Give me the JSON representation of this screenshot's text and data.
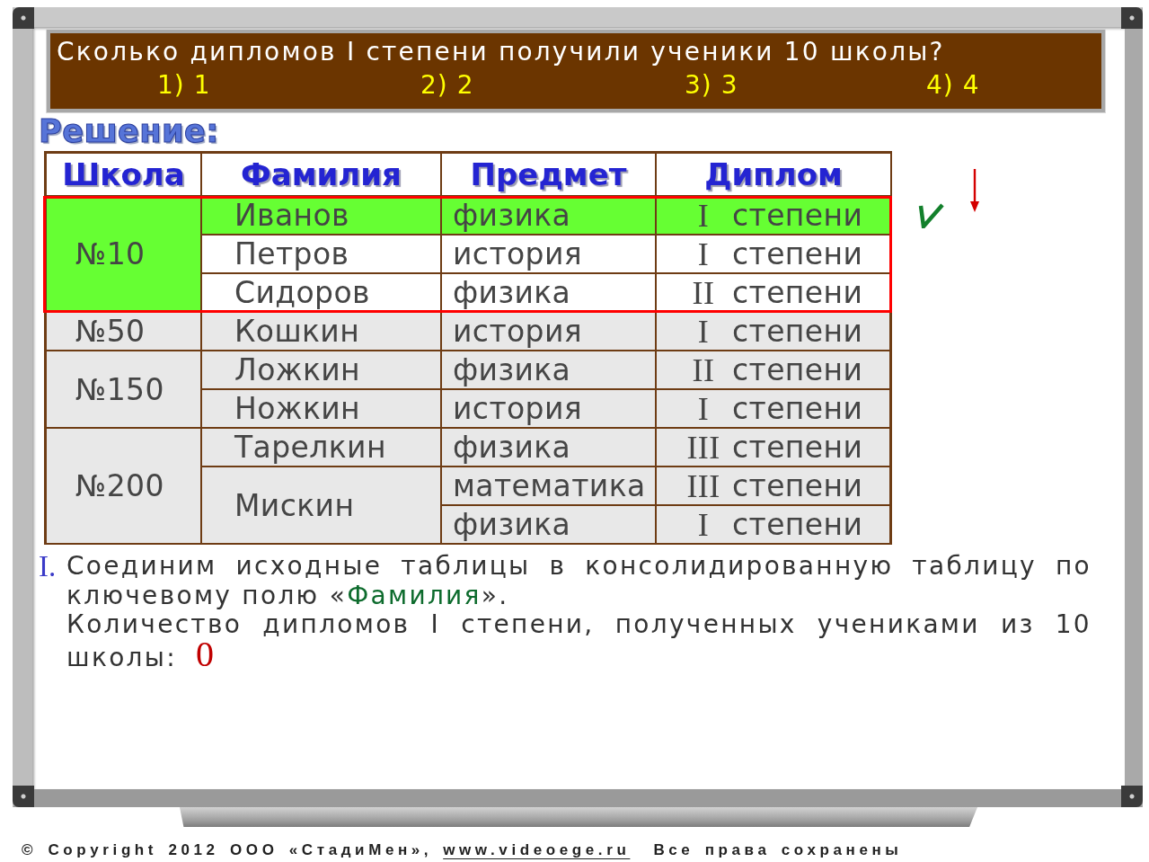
{
  "question": {
    "text": "Сколько дипломов I степени получили ученики 10 школы?",
    "options": [
      "1) 1",
      "2) 2",
      "3) 3",
      "4) 4"
    ]
  },
  "solution_heading": "Решение:",
  "table": {
    "columns": [
      "Школа",
      "Фамилия",
      "Предмет",
      "Диплом"
    ],
    "groups": [
      {
        "school": "№10",
        "selected": true,
        "highlighted": true,
        "students": [
          {
            "name": "Иванов",
            "highlighted": true,
            "subjects": [
              {
                "subject": "физика",
                "degree": "I",
                "diploma": "степени",
                "highlighted": true,
                "checked": true
              }
            ]
          },
          {
            "name": "Петров",
            "highlighted": false,
            "subjects": [
              {
                "subject": "история",
                "degree": "I",
                "diploma": "степени",
                "highlighted": false,
                "checked": false
              }
            ]
          },
          {
            "name": "Сидоров",
            "highlighted": false,
            "subjects": [
              {
                "subject": "физика",
                "degree": "II",
                "diploma": "степени",
                "highlighted": false,
                "checked": false
              }
            ]
          }
        ]
      },
      {
        "school": "№50",
        "selected": false,
        "highlighted": false,
        "students": [
          {
            "name": "Кошкин",
            "highlighted": false,
            "subjects": [
              {
                "subject": "история",
                "degree": "I",
                "diploma": "степени",
                "highlighted": false,
                "checked": false
              }
            ]
          }
        ]
      },
      {
        "school": "№150",
        "selected": false,
        "highlighted": false,
        "students": [
          {
            "name": "Ложкин",
            "highlighted": false,
            "subjects": [
              {
                "subject": "физика",
                "degree": "II",
                "diploma": "степени",
                "highlighted": false,
                "checked": false
              }
            ]
          },
          {
            "name": "Ножкин",
            "highlighted": false,
            "subjects": [
              {
                "subject": "история",
                "degree": "I",
                "diploma": "степени",
                "highlighted": false,
                "checked": false
              }
            ]
          }
        ]
      },
      {
        "school": "№200",
        "selected": false,
        "highlighted": false,
        "students": [
          {
            "name": "Тарелкин",
            "highlighted": false,
            "subjects": [
              {
                "subject": "физика",
                "degree": "III",
                "diploma": "степени",
                "highlighted": false,
                "checked": false
              }
            ]
          },
          {
            "name": "Мискин",
            "highlighted": false,
            "subjects": [
              {
                "subject": "математика",
                "degree": "III",
                "diploma": "степени",
                "highlighted": false,
                "checked": false
              },
              {
                "subject": "физика",
                "degree": "I",
                "diploma": "степени",
                "highlighted": false,
                "checked": false
              }
            ]
          }
        ]
      }
    ]
  },
  "step": {
    "marker": "I.",
    "sentence": [
      {
        "kind": "plain",
        "text": "Соединим исходные таблицы в консолидированную таблицу по ключевому полю «"
      },
      {
        "kind": "field",
        "text": "Фамилия"
      },
      {
        "kind": "plain",
        "text": "»."
      }
    ],
    "result_text": "Количество дипломов I степени, полученных учениками из 10 школы:",
    "answer": "0"
  },
  "footer": {
    "copyright": "© Copyright 2012 ООО «СтадиМен»,",
    "link": "www.videoege.ru",
    "rights": "Все права сохранены"
  }
}
